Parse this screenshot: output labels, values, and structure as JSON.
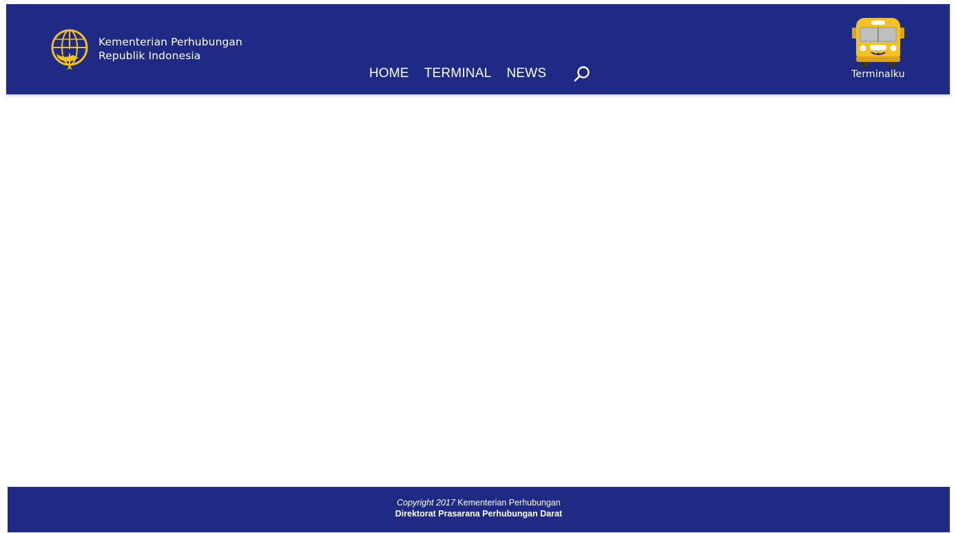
{
  "header": {
    "ministry": {
      "line1": "Kementerian Perhubungan",
      "line2": "Republik Indonesia",
      "logo_icon": "ministry-emblem-icon"
    },
    "nav": [
      {
        "label": "HOME"
      },
      {
        "label": "TERMINAL"
      },
      {
        "label": "NEWS"
      }
    ],
    "search_icon": "search-icon",
    "brand": {
      "name": "Terminalku",
      "icon": "bus-icon"
    }
  },
  "footer": {
    "copyright_italic": "Copyright 2017",
    "copyright_org": "Kementerian Perhubungan",
    "directorate": "Direktorat Prasarana Perhubungan Darat"
  },
  "colors": {
    "primary": "#1f2a85",
    "accent_yellow": "#f4c21f",
    "text": "#ffffff"
  }
}
